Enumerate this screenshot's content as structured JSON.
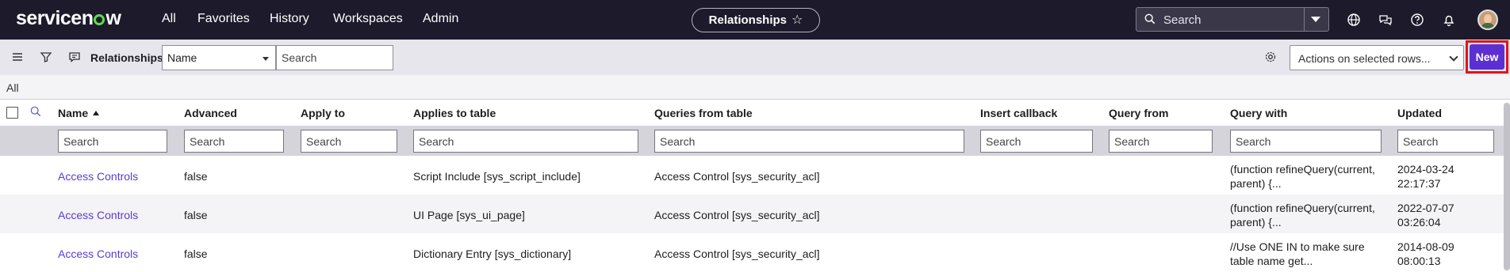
{
  "topnav": {
    "logo_text_a": "servicen",
    "logo_text_b": "w",
    "links": [
      "All",
      "Favorites",
      "History",
      "Workspaces",
      "Admin"
    ],
    "context_pill": "Relationships",
    "search_placeholder": "Search",
    "icons": [
      "globe-icon",
      "chat-icon",
      "help-icon",
      "bell-icon"
    ]
  },
  "toolbar": {
    "title": "Relationships",
    "field_select": "Name",
    "search_placeholder": "Search",
    "actions_select": "Actions on selected rows...",
    "new_label": "New"
  },
  "breadcrumb": "All",
  "table": {
    "columns": [
      "Name",
      "Advanced",
      "Apply to",
      "Applies to table",
      "Queries from table",
      "Insert callback",
      "Query from",
      "Query with",
      "Updated"
    ],
    "filter_placeholder": "Search",
    "rows": [
      {
        "name": "Access Controls",
        "advanced": "false",
        "apply_to": "",
        "applies_to_table": "Script Include [sys_script_include]",
        "queries_from_table": "Access Control [sys_security_acl]",
        "insert_callback": "",
        "query_from": "",
        "query_with_1": "(function refineQuery(current,",
        "query_with_2": "parent) {...",
        "updated_date": "2024-03-24",
        "updated_time": "22:17:37"
      },
      {
        "name": "Access Controls",
        "advanced": "false",
        "apply_to": "",
        "applies_to_table": "UI Page [sys_ui_page]",
        "queries_from_table": "Access Control [sys_security_acl]",
        "insert_callback": "",
        "query_from": "",
        "query_with_1": "(function refineQuery(current,",
        "query_with_2": "parent) {...",
        "updated_date": "2022-07-07",
        "updated_time": "03:26:04"
      },
      {
        "name": "Access Controls",
        "advanced": "false",
        "apply_to": "",
        "applies_to_table": "Dictionary Entry [sys_dictionary]",
        "queries_from_table": "Access Control [sys_security_acl]",
        "insert_callback": "",
        "query_from": "",
        "query_with_1": "//Use ONE IN to make sure",
        "query_with_2": "table name get...",
        "updated_date": "2014-08-09",
        "updated_time": "08:00:13"
      }
    ]
  },
  "colors": {
    "nav_bg": "#1c1a2b",
    "brand_green": "#62d84e",
    "primary_button": "#5c2fd3",
    "link": "#5b3bd1",
    "highlight_border": "#e0151b"
  }
}
